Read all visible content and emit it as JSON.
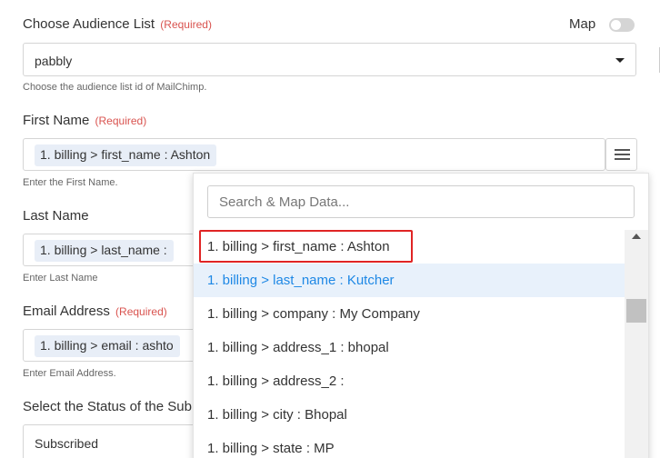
{
  "audience": {
    "label": "Choose Audience List",
    "required": "(Required)",
    "value": "pabbly",
    "help": "Choose the audience list id of MailChimp.",
    "map_label": "Map"
  },
  "first_name": {
    "label": "First Name",
    "required": "(Required)",
    "chip": "1. billing > first_name : Ashton",
    "help": "Enter the First Name."
  },
  "last_name": {
    "label": "Last Name",
    "chip": "1. billing > last_name :",
    "help": "Enter Last Name"
  },
  "email": {
    "label": "Email Address",
    "required": "(Required)",
    "chip": "1. billing > email : ashto",
    "help": "Enter Email Address."
  },
  "status": {
    "label": "Select the Status of the Sub",
    "value": "Subscribed"
  },
  "dropdown": {
    "search_placeholder": "Search & Map Data...",
    "items": [
      "1. billing > first_name : Ashton",
      "1. billing > last_name : Kutcher",
      "1. billing > company : My Company",
      "1. billing > address_1 : bhopal",
      "1. billing > address_2 :",
      "1. billing > city : Bhopal",
      "1. billing > state : MP"
    ]
  }
}
